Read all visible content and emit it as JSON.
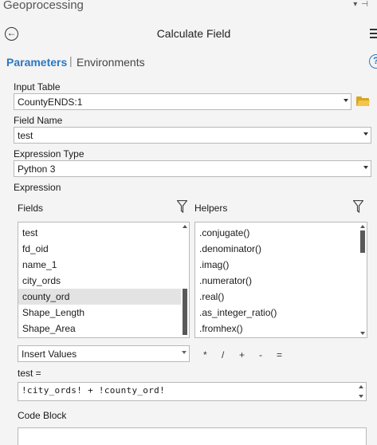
{
  "pane": {
    "title": "Geoprocessing"
  },
  "tool": {
    "title": "Calculate Field"
  },
  "tabs": {
    "parameters": "Parameters",
    "separator": "|",
    "environments": "Environments"
  },
  "icons": {
    "back": "back-arrow-icon",
    "menu": "hamburger-menu-icon",
    "help": "help-icon",
    "folder": "folder-open-icon",
    "filter": "filter-funnel-icon",
    "pin": "pin-icon",
    "dropdown": "dropdown-arrow-icon"
  },
  "colors": {
    "accent": "#2a78c2",
    "folder": "#d9a520",
    "selection": "#e3e3e3"
  },
  "input_table": {
    "label": "Input Table",
    "value": "CountyENDS:1"
  },
  "field_name": {
    "label": "Field Name",
    "value": "test"
  },
  "expression_type": {
    "label": "Expression Type",
    "value": "Python 3"
  },
  "expression": {
    "label": "Expression",
    "fields_label": "Fields",
    "helpers_label": "Helpers",
    "fields": [
      "test",
      "fd_oid",
      "name_1",
      "city_ords",
      "county_ord",
      "Shape_Length",
      "Shape_Area"
    ],
    "selected_field": "county_ord",
    "helpers": [
      ".conjugate()",
      ".denominator()",
      ".imag()",
      ".numerator()",
      ".real()",
      ".as_integer_ratio()",
      ".fromhex()"
    ],
    "insert_mode": "Insert Values",
    "operators": [
      "*",
      "/",
      "+",
      "-",
      "="
    ],
    "target_label": "test =",
    "value": "!city_ords! + !county_ord!"
  },
  "code_block": {
    "label": "Code Block"
  }
}
